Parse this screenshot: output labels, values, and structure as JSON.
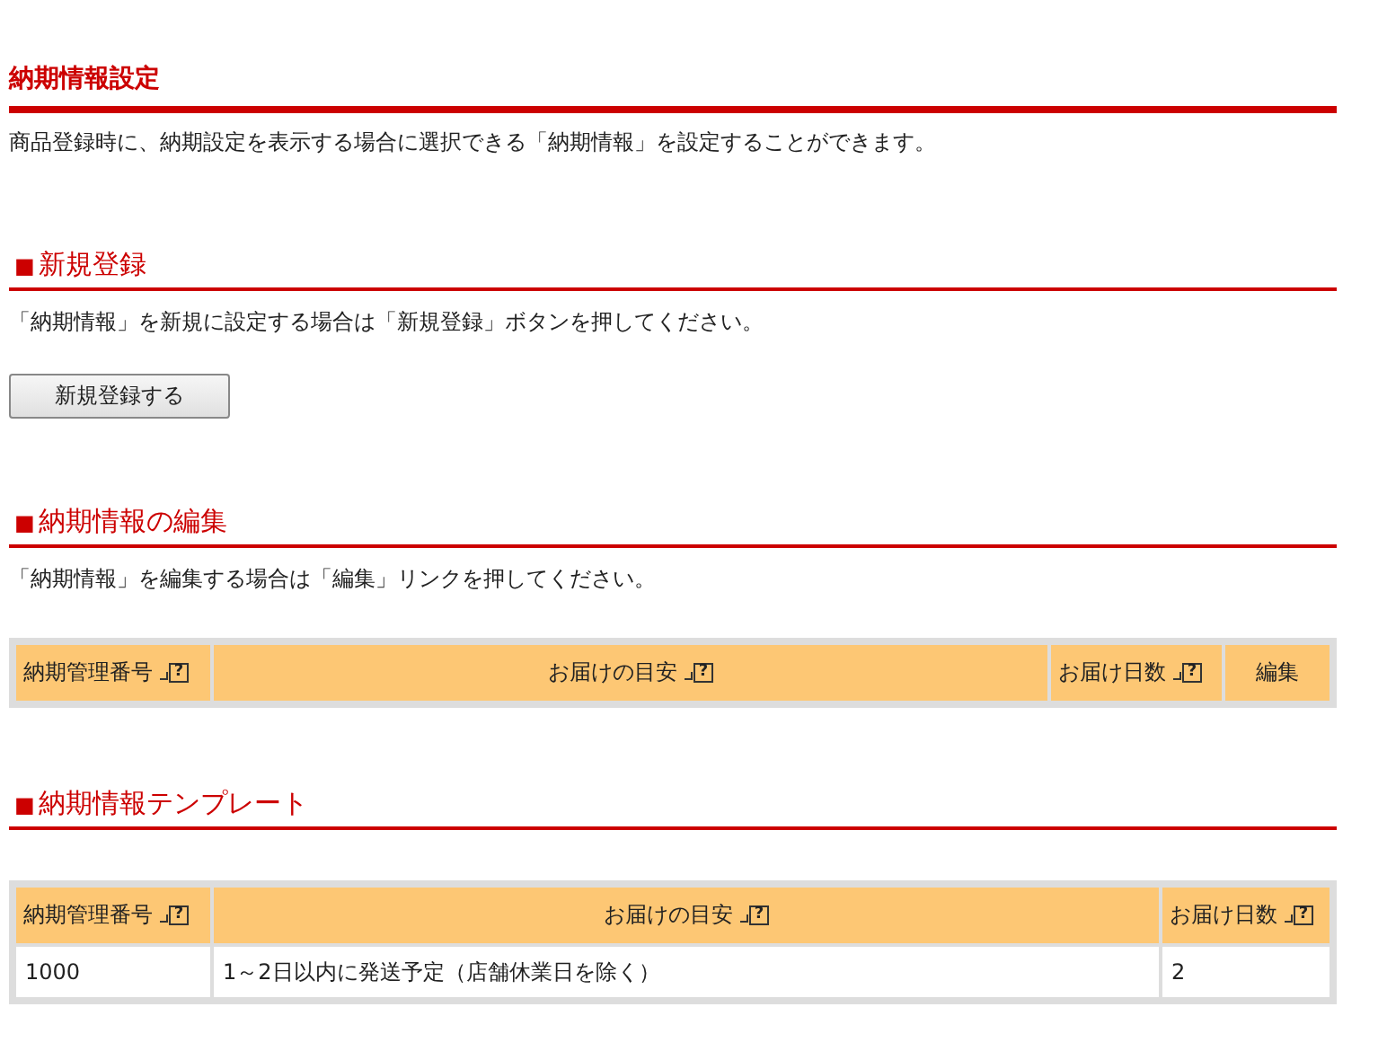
{
  "page_title": "納期情報設定",
  "description": "商品登録時に、納期設定を表示する場合に選択できる「納期情報」を設定することができます。",
  "sections": [
    {
      "kind": "register",
      "marker": "■",
      "title": "新規登録",
      "description": "「納期情報」を新規に設定する場合は「新規登録」ボタンを押してください。",
      "button": "新規登録する"
    },
    {
      "kind": "table",
      "marker": "■",
      "title": "納期情報の編集",
      "description": "「納期情報」を編集する場合は「編集」リンクを押してください。",
      "table": {
        "columns": [
          {
            "label": "納期管理番号",
            "help": "?"
          },
          {
            "label": "お届けの目安",
            "help": "?"
          },
          {
            "label": "お届け日数",
            "help": "?"
          },
          {
            "label": "編集"
          }
        ]
      }
    },
    {
      "kind": "table",
      "marker": "■",
      "title": "納期情報テンプレート",
      "table": {
        "columns": [
          {
            "label": "納期管理番号",
            "help": "?"
          },
          {
            "label": "お届けの目安",
            "help": "?"
          },
          {
            "label": "お届け日数",
            "help": "?"
          }
        ],
        "rows": [
          [
            "1000",
            "1～2日以内に発送予定（店舗休業日を除く）",
            "2"
          ]
        ]
      }
    }
  ]
}
